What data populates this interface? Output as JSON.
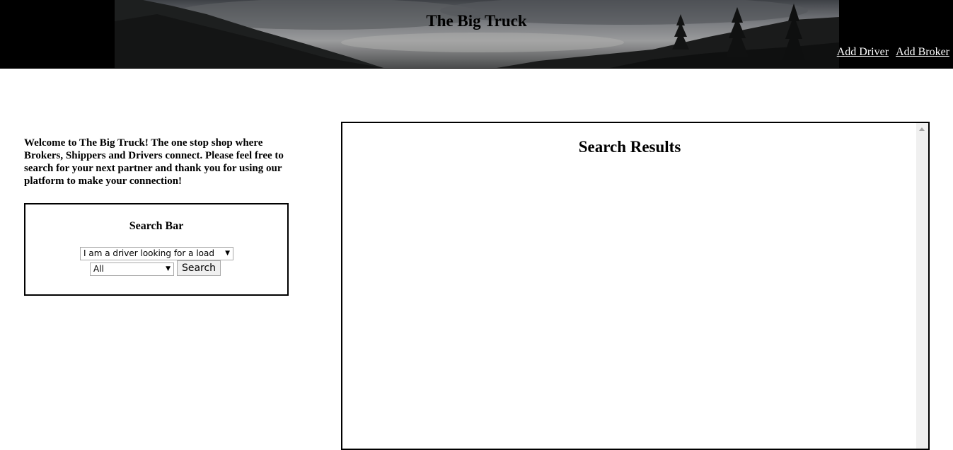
{
  "header": {
    "title": "The Big Truck",
    "nav": {
      "add_driver": "Add Driver",
      "add_broker": "Add Broker"
    }
  },
  "welcome": {
    "text": "Welcome to The Big Truck! The one stop shop where Brokers, Shippers and Drivers connect. Please feel free to search for your next partner and thank you for using our platform to make your connection!"
  },
  "search_bar": {
    "title": "Search Bar",
    "role_select": {
      "selected": "I am a driver looking for a load"
    },
    "filter_select": {
      "selected": "All"
    },
    "search_button": "Search"
  },
  "results": {
    "title": "Search Results"
  },
  "icons": {
    "dropdown": "chevron-down-icon",
    "scroll_up": "scroll-up-arrow-icon"
  }
}
